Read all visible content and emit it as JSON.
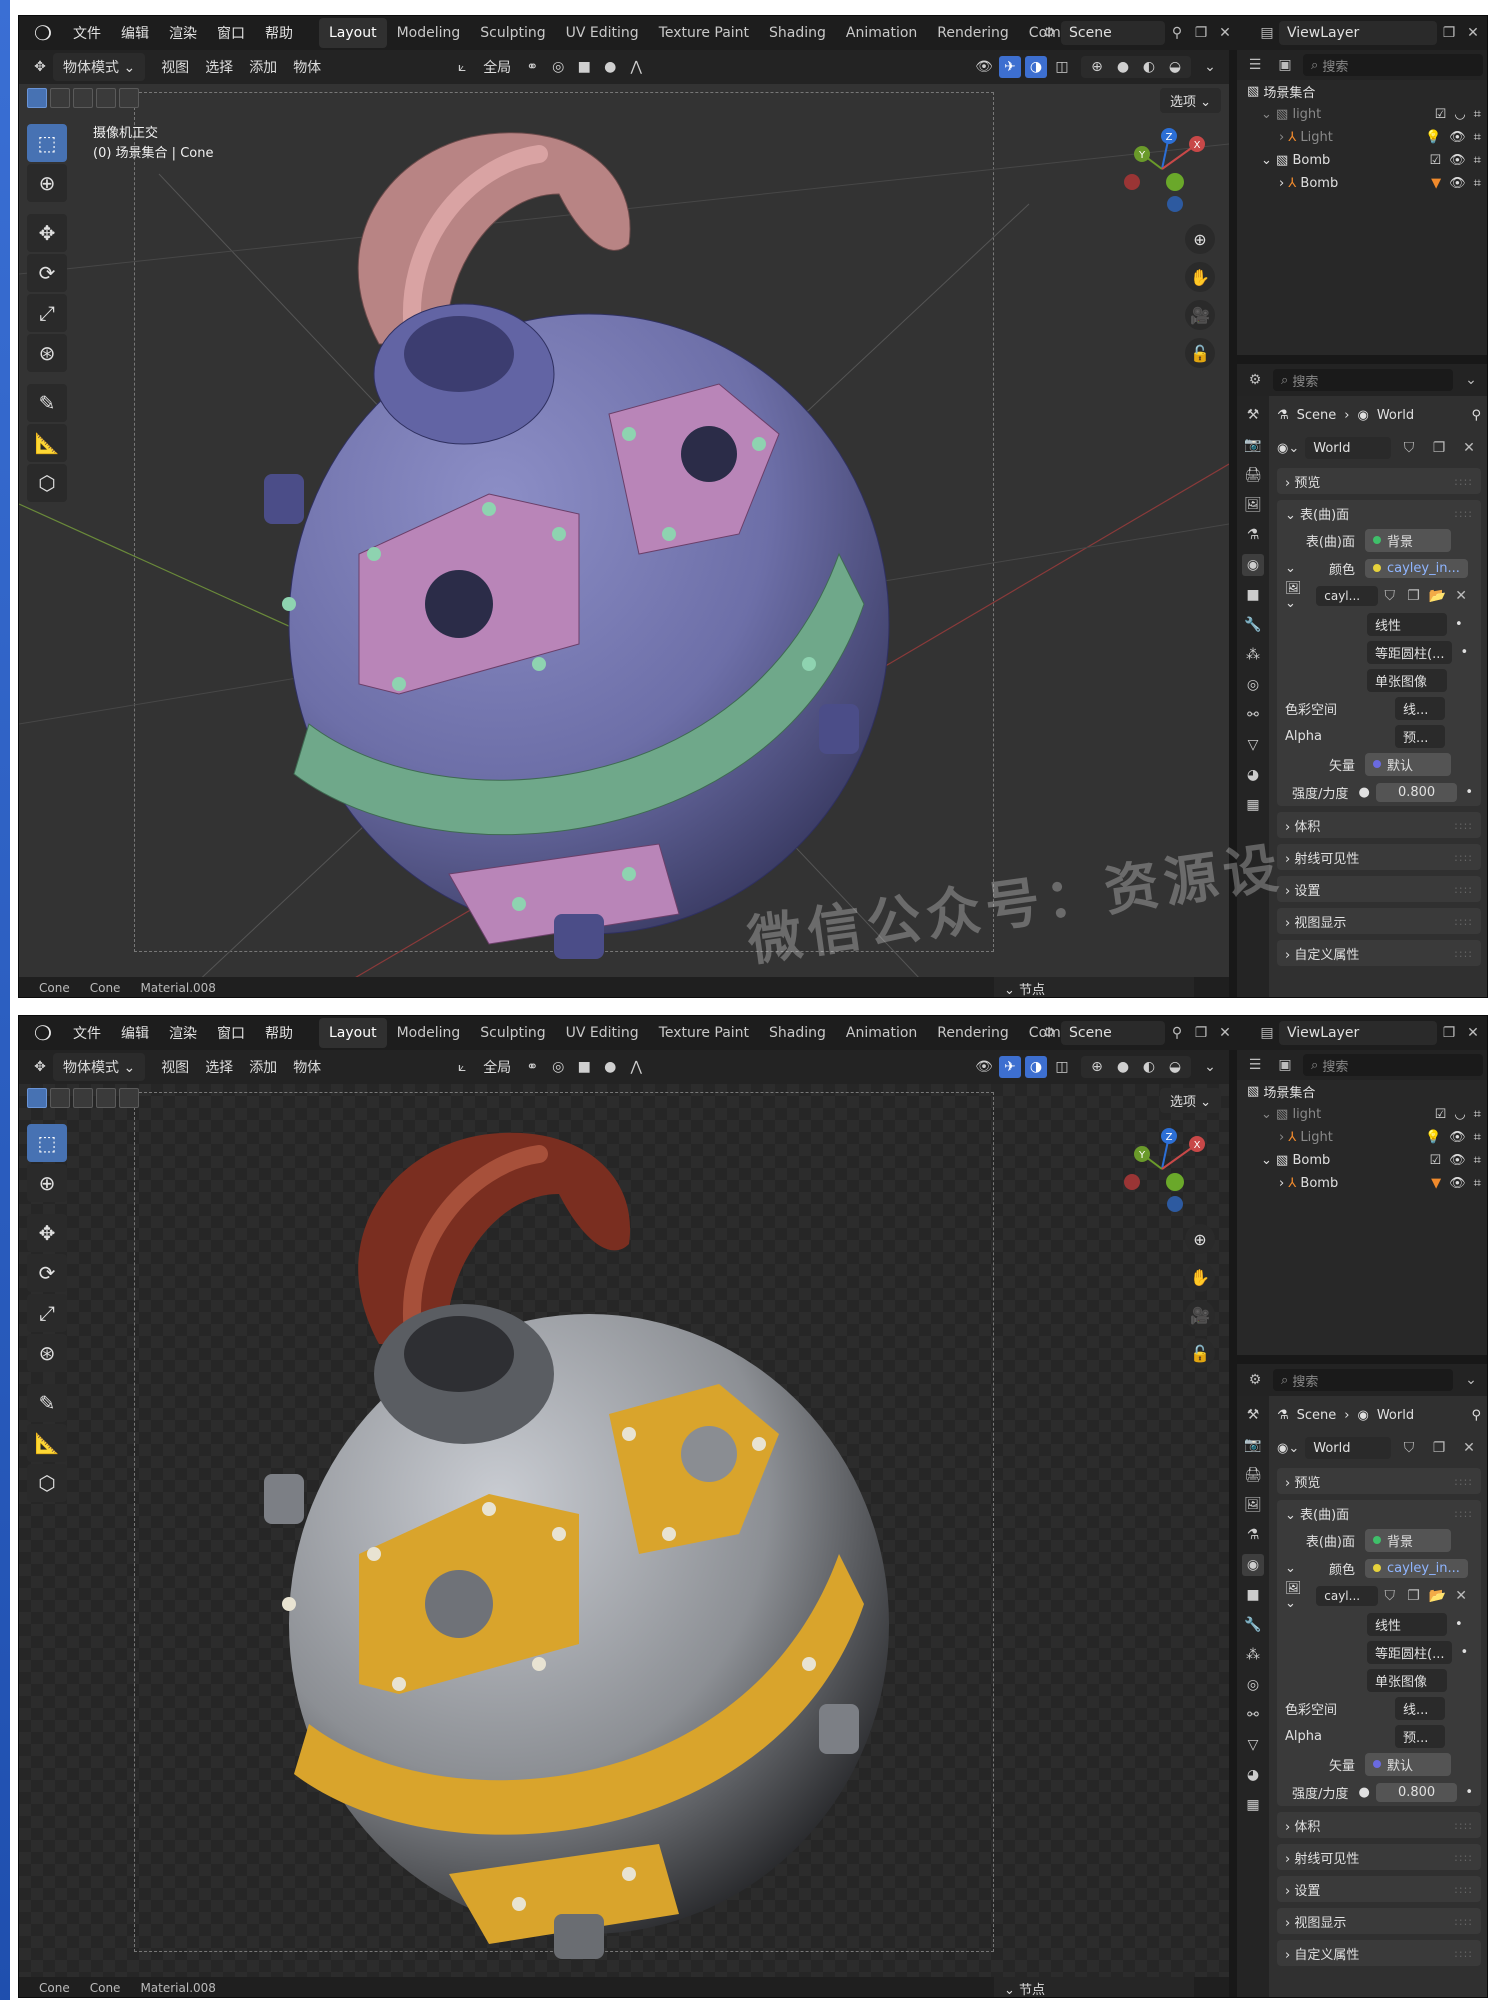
{
  "menu": [
    "文件",
    "编辑",
    "渲染",
    "窗口",
    "帮助"
  ],
  "workspaces": [
    "Layout",
    "Modeling",
    "Sculpting",
    "UV Editing",
    "Texture Paint",
    "Shading",
    "Animation",
    "Rendering",
    "Compositing"
  ],
  "active_workspace": "Layout",
  "scene": "Scene",
  "view_layer": "ViewLayer",
  "header": {
    "mode": "物体模式",
    "view": "视图",
    "select": "选择",
    "add": "添加",
    "object": "物体",
    "transform_orient": "全局"
  },
  "viewport": {
    "options": "选项",
    "camera_label": "摄像机正交",
    "collection_label": "(0) 场景集合 | Cone",
    "gizmo": {
      "z": "Z",
      "y": "Y",
      "x": "X"
    }
  },
  "watermark": "微信公众号：资源设",
  "outliner": {
    "search_placeholder": "搜索",
    "root": "场景集合",
    "rows": [
      {
        "label": "light",
        "indent": 1,
        "dim": true
      },
      {
        "label": "Light",
        "indent": 2,
        "dim": true,
        "badge": "3"
      },
      {
        "label": "Bomb",
        "indent": 1,
        "dim": false
      },
      {
        "label": "Bomb",
        "indent": 2,
        "dim": false,
        "badge": ""
      }
    ]
  },
  "properties": {
    "search_placeholder": "搜索",
    "breadcrumb_scene": "Scene",
    "breadcrumb_world": "World",
    "world_name": "World",
    "panels": {
      "preview": "预览",
      "surface": "表(曲)面",
      "volume": "体积",
      "ray_visibility": "射线可见性",
      "settings": "设置",
      "viewport_display": "视图显示",
      "custom_props": "自定义属性"
    },
    "surface_label": "表(曲)面",
    "surface_value": "背景",
    "color_label": "颜色",
    "color_value": "cayley_in...",
    "image_name": "cayl...",
    "interp": "线性",
    "projection": "等距圆柱(...",
    "source": "单张图像",
    "colorspace_label": "色彩空间",
    "colorspace_value": "线...",
    "alpha_label": "Alpha",
    "alpha_value": "预...",
    "vector_label": "矢量",
    "vector_value": "默认",
    "strength_label": "强度/力度",
    "strength_value": "0.800"
  },
  "statusbar": {
    "obj1": "Cone",
    "obj2": "Cone",
    "material": "Material.008"
  },
  "node_header": "节点",
  "colors": {
    "accent": "#4772b3",
    "clay_body": "#6d6fa8",
    "clay_band": "#6fa88a",
    "clay_plate": "#b985b8",
    "clay_rope": "#b88484",
    "gold": "#d9a42c",
    "steel": "#8c8f94",
    "rope_render": "#7a2e20"
  }
}
